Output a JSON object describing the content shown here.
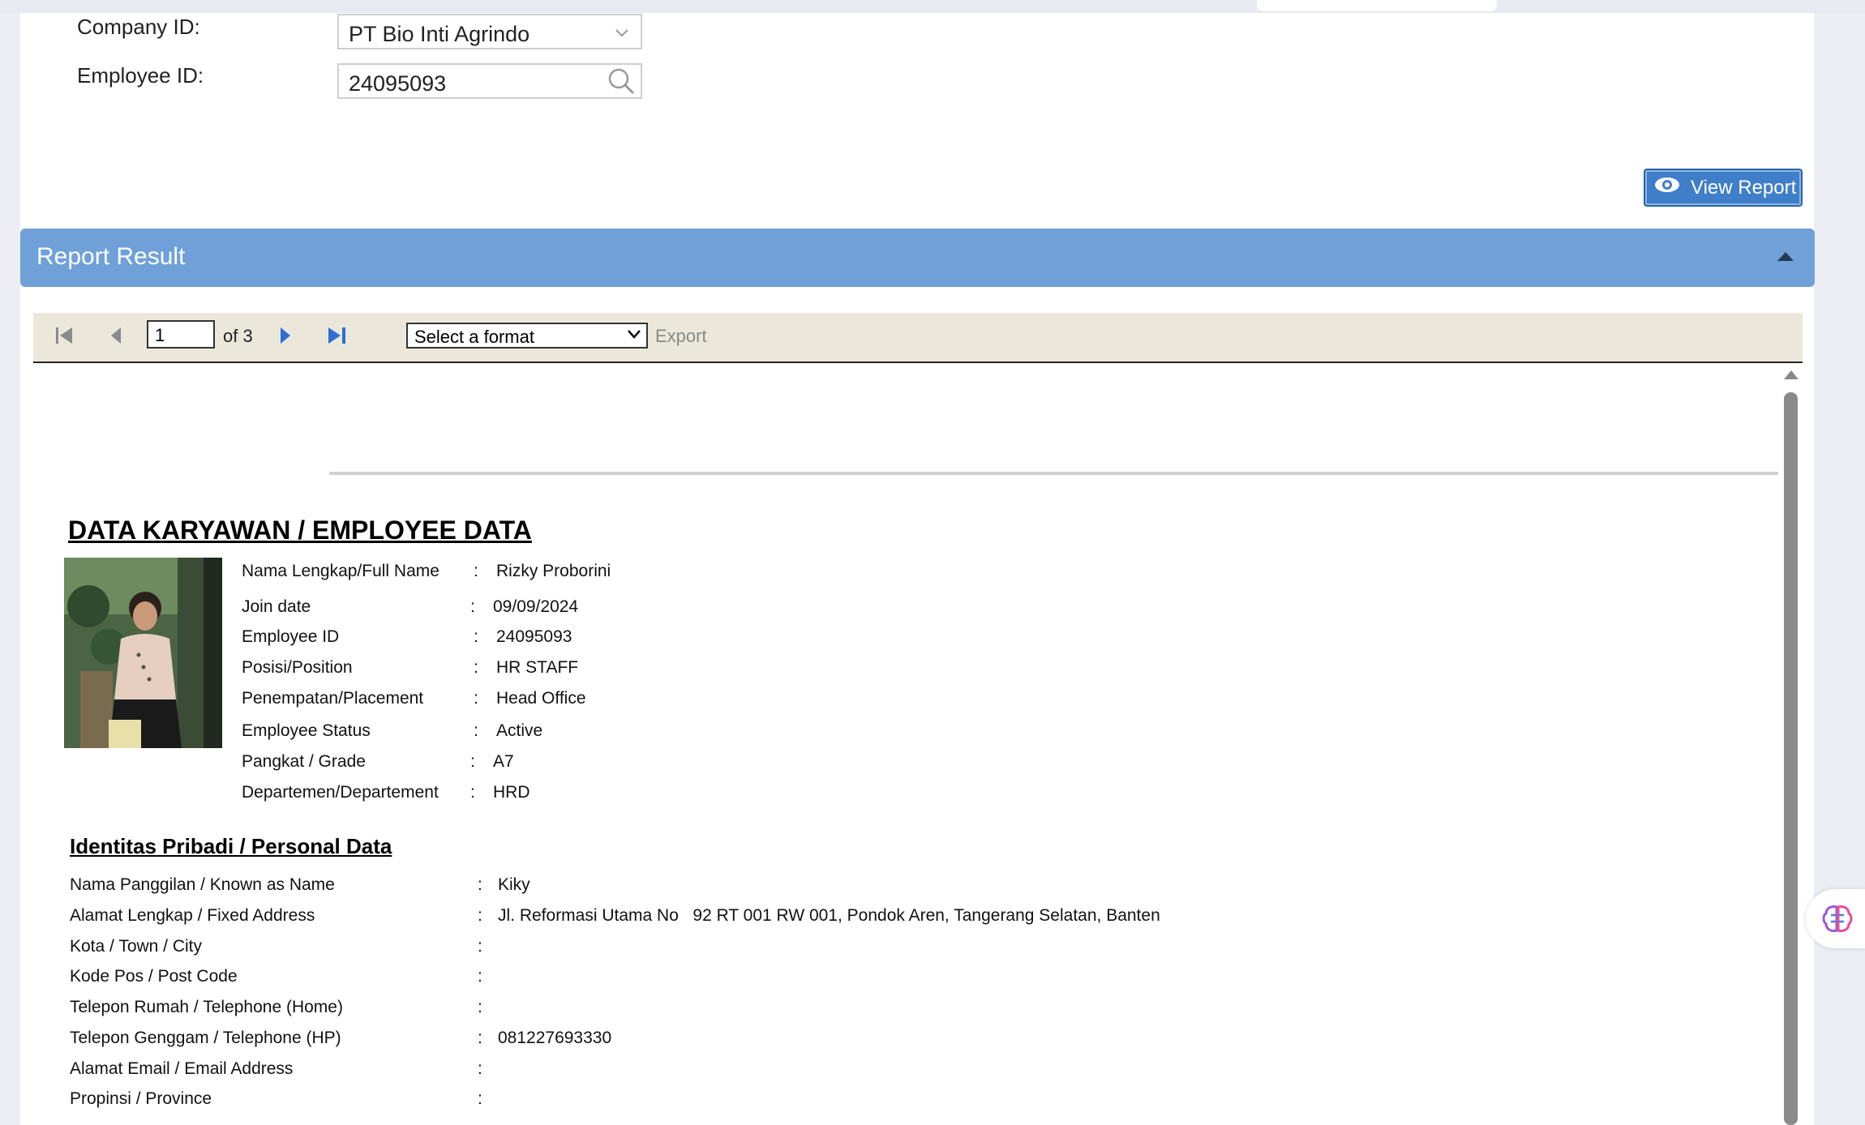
{
  "form": {
    "company_label": "Company ID:",
    "company_value": "PT Bio Inti Agrindo",
    "employee_label": "Employee ID:",
    "employee_value": "24095093",
    "view_report": "View Report"
  },
  "result": {
    "title": "Report Result"
  },
  "toolbar": {
    "page": "1",
    "of_pages": "of 3",
    "format_placeholder": "Select a format",
    "export": "Export"
  },
  "report": {
    "title": "DATA KARYAWAN / EMPLOYEE DATA",
    "employee": [
      {
        "label": "Nama Lengkap/Full Name",
        "value": "Rizky Proborini"
      },
      {
        "label": "Join date",
        "value": "09/09/2024"
      },
      {
        "label": "Employee ID",
        "value": "24095093"
      },
      {
        "label": "Posisi/Position",
        "value": "HR STAFF"
      },
      {
        "label": "Penempatan/Placement",
        "value": "Head Office"
      },
      {
        "label": "Employee Status",
        "value": "Active"
      },
      {
        "label": "Pangkat / Grade",
        "value": "A7"
      },
      {
        "label": "Departemen/Departement",
        "value": "HRD"
      }
    ],
    "personal_title": "Identitas Pribadi / Personal Data",
    "personal": [
      {
        "label": "Nama Panggilan / Known as Name",
        "value": "Kiky"
      },
      {
        "label": "Alamat Lengkap / Fixed Address",
        "value": "Jl. Reformasi Utama No   92 RT 001 RW 001, Pondok Aren, Tangerang Selatan, Banten"
      },
      {
        "label": "Kota / Town / City",
        "value": ""
      },
      {
        "label": "Kode Pos / Post Code",
        "value": ""
      },
      {
        "label": "Telepon Rumah / Telephone (Home)",
        "value": ""
      },
      {
        "label": "Telepon Genggam / Telephone (HP)",
        "value": "081227693330"
      },
      {
        "label": "Alamat Email / Email Address",
        "value": ""
      },
      {
        "label": "Propinsi / Province",
        "value": ""
      }
    ],
    "colon": ":"
  },
  "icons": {
    "dropdown": "chevron-down-icon",
    "search": "search-icon",
    "eye": "eye-icon",
    "collapse": "caret-up-icon",
    "first": "first-page-icon",
    "prev": "prev-page-icon",
    "next": "next-page-icon",
    "last": "last-page-icon",
    "assistant": "brain-icon"
  },
  "colors": {
    "header_bar": "#6fa0d8",
    "button": "#3f7ec8",
    "toolbar": "#ebe8db"
  }
}
